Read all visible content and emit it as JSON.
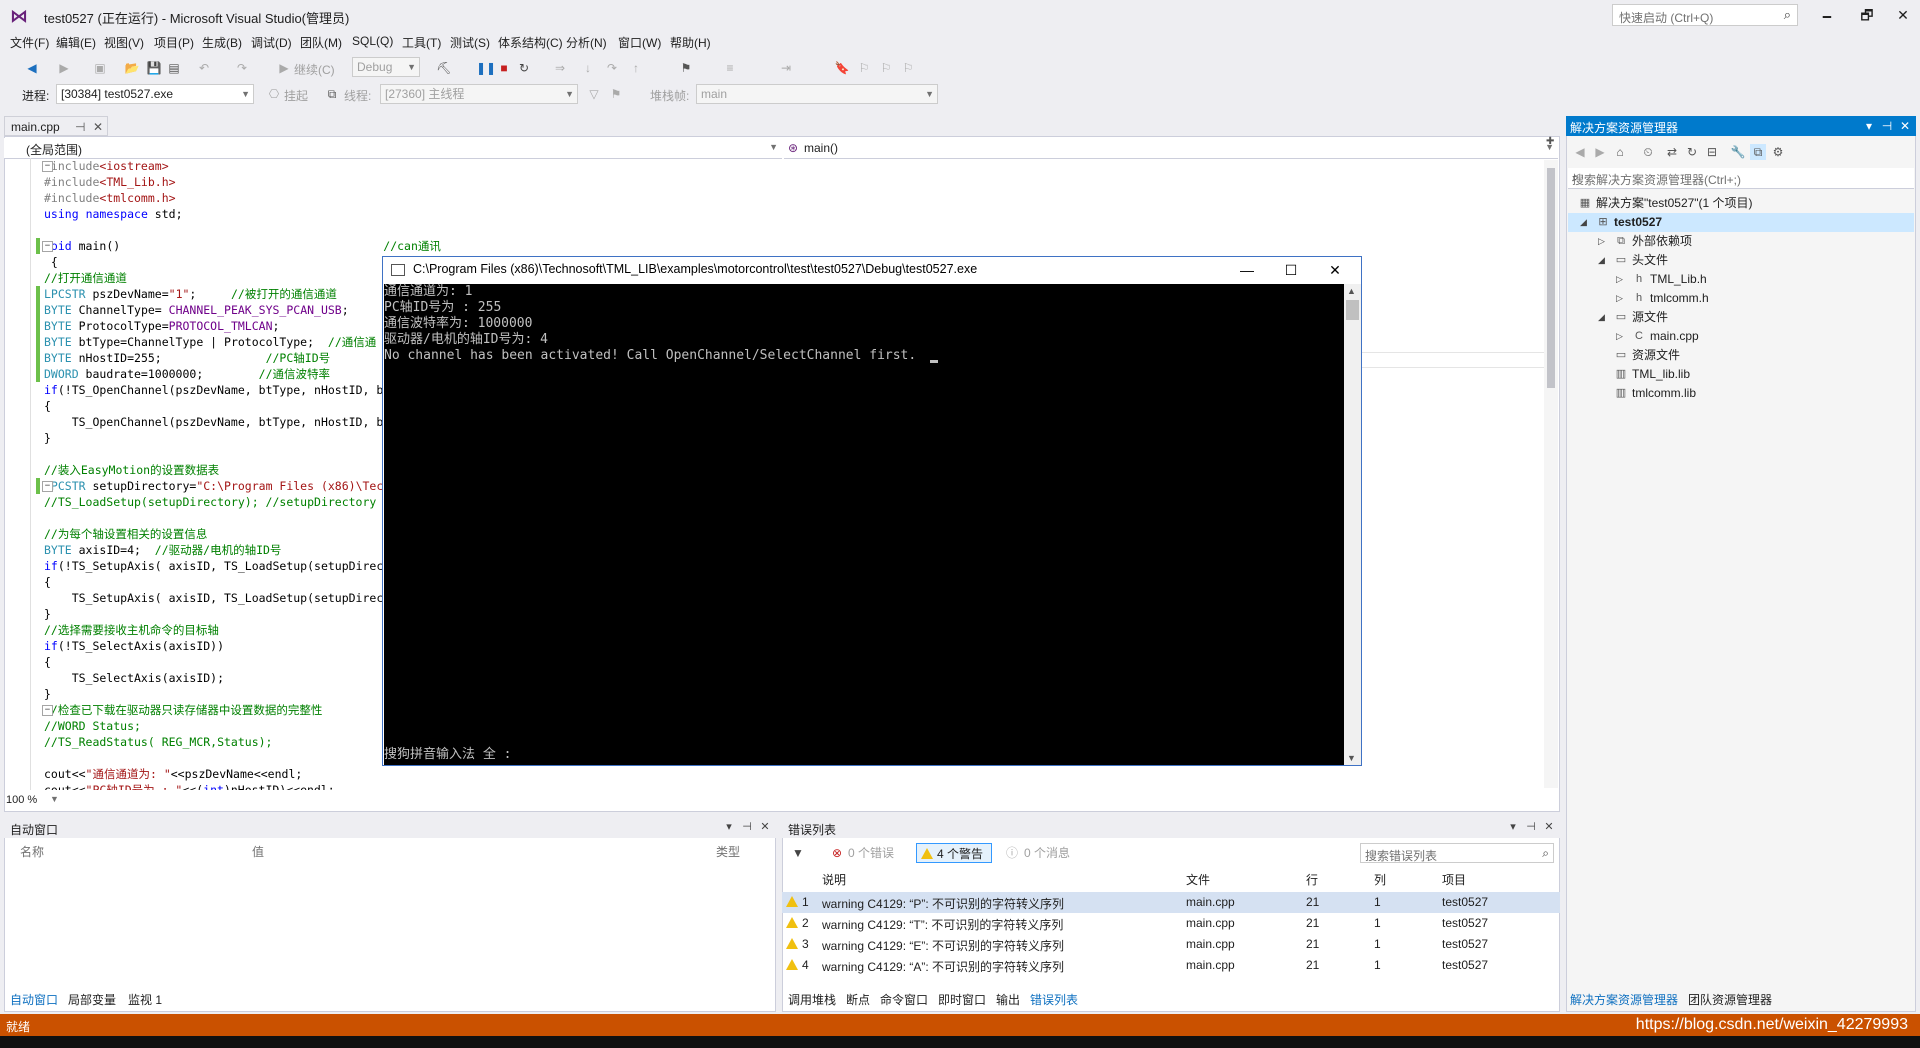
{
  "window": {
    "title": "test0527 (正在运行) - Microsoft Visual Studio(管理员)",
    "quick_launch_placeholder": "快速启动 (Ctrl+Q)",
    "minimize": "🗕",
    "maximize": "🗗",
    "close": "✕"
  },
  "menu": [
    "文件(F)",
    "编辑(E)",
    "视图(V)",
    "项目(P)",
    "生成(B)",
    "调试(D)",
    "团队(M)",
    "SQL(Q)",
    "工具(T)",
    "测试(S)",
    "体系结构(C)",
    "分析(N)",
    "窗口(W)",
    "帮助(H)"
  ],
  "toolbar": {
    "continue_label": "继续(C)",
    "config": "Debug",
    "process_label": "进程:",
    "process_value": "[30384] test0527.exe",
    "suspend_label": "挂起",
    "thread_label": "线程:",
    "thread_value": "[27360] 主线程",
    "stackframe_label": "堆栈帧:",
    "stackframe_value": "main"
  },
  "editor": {
    "tab_label": "main.cpp",
    "scope": "(全局范围)",
    "function": "main()",
    "zoom": "100 %",
    "lines": [
      [
        [
          "cm-none",
          "#include"
        ],
        [
          "st",
          "<iostream>"
        ]
      ],
      [
        [
          "cm-none",
          "#include"
        ],
        [
          "st",
          "<TML_Lib.h>"
        ]
      ],
      [
        [
          "cm-none",
          "#include"
        ],
        [
          "st",
          "<tmlcomm.h>"
        ]
      ],
      [
        [
          "kw",
          "using"
        ],
        [
          "n",
          " "
        ],
        [
          "kw",
          "namespace"
        ],
        [
          "n",
          " std;"
        ]
      ],
      [
        [
          "n",
          ""
        ]
      ],
      [
        [
          "kw",
          "void"
        ],
        [
          "n",
          " main()                                      "
        ],
        [
          "cm",
          "//can通讯"
        ]
      ],
      [
        [
          "n",
          " {"
        ]
      ],
      [
        [
          "cm",
          "//打开通信通道"
        ]
      ],
      [
        [
          "ty",
          "LPCSTR"
        ],
        [
          "n",
          " pszDevName="
        ],
        [
          "st",
          "\"1\""
        ],
        [
          "n",
          ";     "
        ],
        [
          "cm",
          "//被打开的通信通道"
        ]
      ],
      [
        [
          "ty",
          "BYTE"
        ],
        [
          "n",
          " ChannelType= "
        ],
        [
          "mc",
          "CHANNEL_PEAK_SYS_PCAN_USB"
        ],
        [
          "n",
          ";"
        ]
      ],
      [
        [
          "ty",
          "BYTE"
        ],
        [
          "n",
          " ProtocolType="
        ],
        [
          "mc",
          "PROTOCOL_TMLCAN"
        ],
        [
          "n",
          ";"
        ]
      ],
      [
        [
          "ty",
          "BYTE"
        ],
        [
          "n",
          " btType=ChannelType | ProtocolType;  "
        ],
        [
          "cm",
          "//通信通"
        ]
      ],
      [
        [
          "ty",
          "BYTE"
        ],
        [
          "n",
          " nHostID=255;               "
        ],
        [
          "cm",
          "//PC轴ID号"
        ]
      ],
      [
        [
          "ty",
          "DWORD"
        ],
        [
          "n",
          " baudrate=1000000;        "
        ],
        [
          "cm",
          "//通信波特率"
        ]
      ],
      [
        [
          "kw",
          "if"
        ],
        [
          "n",
          "(!TS_OpenChannel(pszDevName, btType, nHostID, b"
        ]
      ],
      [
        [
          "n",
          "{"
        ]
      ],
      [
        [
          "n",
          "    TS_OpenChannel(pszDevName, btType, nHostID, b"
        ]
      ],
      [
        [
          "n",
          "}"
        ]
      ],
      [
        [
          "n",
          ""
        ]
      ],
      [
        [
          "cm",
          "//装入EasyMotion的设置数据表"
        ]
      ],
      [
        [
          "ty",
          "LPCSTR"
        ],
        [
          "n",
          " setupDirectory="
        ],
        [
          "st",
          "\"C:\\Program Files (x86)\\Tec"
        ]
      ],
      [
        [
          "cm",
          "//TS_LoadSetup(setupDirectory); //setupDirectory"
        ]
      ],
      [
        [
          "n",
          ""
        ]
      ],
      [
        [
          "cm",
          "//为每个轴设置相关的设置信息"
        ]
      ],
      [
        [
          "ty",
          "BYTE"
        ],
        [
          "n",
          " axisID=4;  "
        ],
        [
          "cm",
          "//驱动器/电机的轴ID号"
        ]
      ],
      [
        [
          "kw",
          "if"
        ],
        [
          "n",
          "(!TS_SetupAxis( axisID, TS_LoadSetup(setupDirec"
        ]
      ],
      [
        [
          "n",
          "{"
        ]
      ],
      [
        [
          "n",
          "    TS_SetupAxis( axisID, TS_LoadSetup(setupDirec"
        ]
      ],
      [
        [
          "n",
          "}"
        ]
      ],
      [
        [
          "cm",
          "//选择需要接收主机命令的目标轴"
        ]
      ],
      [
        [
          "kw",
          "if"
        ],
        [
          "n",
          "(!TS_SelectAxis(axisID))"
        ]
      ],
      [
        [
          "n",
          "{"
        ]
      ],
      [
        [
          "n",
          "    TS_SelectAxis(axisID);"
        ]
      ],
      [
        [
          "n",
          "}"
        ]
      ],
      [
        [
          "cm",
          "//检查已下载在驱动器只读存储器中设置数据的完整性"
        ]
      ],
      [
        [
          "cm",
          "//WORD Status;"
        ]
      ],
      [
        [
          "cm",
          "//TS_ReadStatus( REG_MCR,Status);"
        ]
      ],
      [
        [
          "n",
          ""
        ]
      ],
      [
        [
          "n",
          "cout<<"
        ],
        [
          "st",
          "\"通信通道为: \""
        ],
        [
          "n",
          "<<pszDevName<<endl;"
        ]
      ],
      [
        [
          "n",
          "cout<<"
        ],
        [
          "st",
          "\"PC轴ID号为 : \""
        ],
        [
          "n",
          "<<("
        ],
        [
          "kw",
          "int"
        ],
        [
          "n",
          ")nHostID)<<endl;"
        ]
      ]
    ]
  },
  "console": {
    "title": "C:\\Program Files (x86)\\Technosoft\\TML_LIB\\examples\\motorcontrol\\test\\test0527\\Debug\\test0527.exe",
    "lines": [
      "通信通道为: 1",
      "PC轴ID号为 : 255",
      "通信波特率为: 1000000",
      "驱动器/电机的轴ID号为: 4",
      "No channel has been activated! Call OpenChannel/SelectChannel first."
    ],
    "ime": "搜狗拼音输入法 全 :"
  },
  "solution_explorer": {
    "title": "解决方案资源管理器",
    "search_placeholder": "搜索解决方案资源管理器(Ctrl+;)",
    "items": [
      {
        "label": "解决方案\"test0527\"(1 个项目)",
        "indent": 0,
        "icon": "solution-icon"
      },
      {
        "label": "test0527",
        "indent": 1,
        "icon": "project-icon",
        "bold": true,
        "selected": true,
        "expanded": true
      },
      {
        "label": "外部依赖项",
        "indent": 2,
        "icon": "dependencies-icon",
        "collapsed": true
      },
      {
        "label": "头文件",
        "indent": 2,
        "icon": "folder-icon",
        "expanded": true
      },
      {
        "label": "TML_Lib.h",
        "indent": 3,
        "icon": "header-file-icon",
        "collapsed": true
      },
      {
        "label": "tmlcomm.h",
        "indent": 3,
        "icon": "header-file-icon",
        "collapsed": true
      },
      {
        "label": "源文件",
        "indent": 2,
        "icon": "folder-icon",
        "expanded": true
      },
      {
        "label": "main.cpp",
        "indent": 3,
        "icon": "cpp-file-icon",
        "collapsed": true
      },
      {
        "label": "资源文件",
        "indent": 2,
        "icon": "folder-icon"
      },
      {
        "label": "TML_lib.lib",
        "indent": 2,
        "icon": "lib-file-icon"
      },
      {
        "label": "tmlcomm.lib",
        "indent": 2,
        "icon": "lib-file-icon"
      }
    ],
    "footer_tabs": [
      "解决方案资源管理器",
      "团队资源管理器"
    ]
  },
  "autos": {
    "title": "自动窗口",
    "columns": [
      "名称",
      "值",
      "类型"
    ],
    "tabs": [
      "自动窗口",
      "局部变量",
      "监视 1"
    ]
  },
  "errors": {
    "title": "错误列表",
    "errors_btn": "0 个错误",
    "warnings_btn": "4 个警告",
    "messages_btn": "0 个消息",
    "search_placeholder": "搜索错误列表",
    "columns": [
      "说明",
      "文件",
      "行",
      "列",
      "项目"
    ],
    "rows": [
      {
        "n": "1",
        "desc": "warning C4129: “P”: 不可识别的字符转义序列",
        "file": "main.cpp",
        "line": "21",
        "col": "1",
        "project": "test0527"
      },
      {
        "n": "2",
        "desc": "warning C4129: “T”: 不可识别的字符转义序列",
        "file": "main.cpp",
        "line": "21",
        "col": "1",
        "project": "test0527"
      },
      {
        "n": "3",
        "desc": "warning C4129: “E”: 不可识别的字符转义序列",
        "file": "main.cpp",
        "line": "21",
        "col": "1",
        "project": "test0527"
      },
      {
        "n": "4",
        "desc": "warning C4129: “A”: 不可识别的字符转义序列",
        "file": "main.cpp",
        "line": "21",
        "col": "1",
        "project": "test0527"
      }
    ],
    "tabs": [
      "调用堆栈",
      "断点",
      "命令窗口",
      "即时窗口",
      "输出",
      "错误列表"
    ]
  },
  "status": {
    "ready": "就绪",
    "url": "https://blog.csdn.net/weixin_42279993"
  },
  "colors": {
    "accent": "#007acc",
    "status": "#ca5100",
    "console_bg": "#000000"
  }
}
